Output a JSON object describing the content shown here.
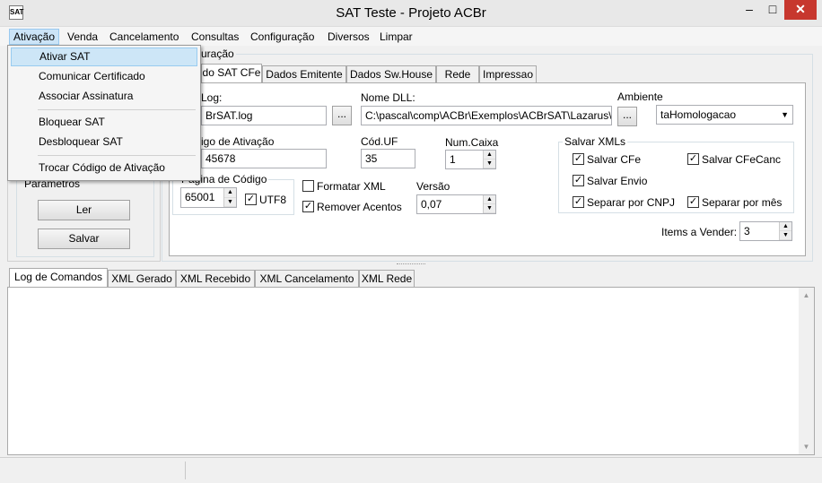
{
  "window": {
    "title": "SAT Teste - Projeto ACBr",
    "icon_text": "SAT",
    "minimize": "‒",
    "maximize": "□",
    "close": "✕"
  },
  "menu": [
    "Ativação",
    "Venda",
    "Cancelamento",
    "Consultas",
    "Configuração",
    "Diversos",
    "Limpar"
  ],
  "dropdown": {
    "items": [
      "Ativar SAT",
      "Comunicar Certificado",
      "Associar Assinatura",
      "Bloquear SAT",
      "Desbloquear SAT",
      "Trocar  Código de Ativação"
    ]
  },
  "left_panel": {
    "group_label": "Parametros",
    "ler": "Ler",
    "salvar": "Salvar"
  },
  "config": {
    "group_label": "uração",
    "tabs": [
      "do SAT CFe",
      "Dados Emitente",
      "Dados Sw.House",
      "Rede",
      "Impressao"
    ],
    "log_label": "Log:",
    "log_value": "BrSAT.log",
    "browse": "...",
    "dll_label": "Nome DLL:",
    "dll_value": "C:\\pascal\\comp\\ACBr\\Exemplos\\ACBrSAT\\Lazarus\\",
    "ambiente_label": "Ambiente",
    "ambiente_value": "taHomologacao",
    "codigo_label": "igo de Ativação",
    "codigo_value": "45678",
    "coduf_label": "Cód.UF",
    "coduf_value": "35",
    "numcaixa_label": "Num.Caixa",
    "numcaixa_value": "1",
    "pagina_label": "Pagina de Código",
    "pagina_value": "65001",
    "utf8_label": "UTF8",
    "formatar_label": "Formatar XML",
    "remover_label": "Remover Acentos",
    "versao_label": "Versão",
    "versao_value": "0,07",
    "salvar_xmls_label": "Salvar XMLs",
    "salvar_cfe": "Salvar CFe",
    "salvar_cfecanc": "Salvar CFeCanc",
    "salvar_envio": "Salvar Envio",
    "separar_cnpj": "Separar por CNPJ",
    "separar_mes": "Separar por mês",
    "items_label": "Items a Vender:",
    "items_value": "3"
  },
  "bottom_tabs": [
    "Log de Comandos",
    "XML Gerado",
    "XML Recebido",
    "XML Cancelamento",
    "XML Rede"
  ],
  "check_mark": "✓"
}
